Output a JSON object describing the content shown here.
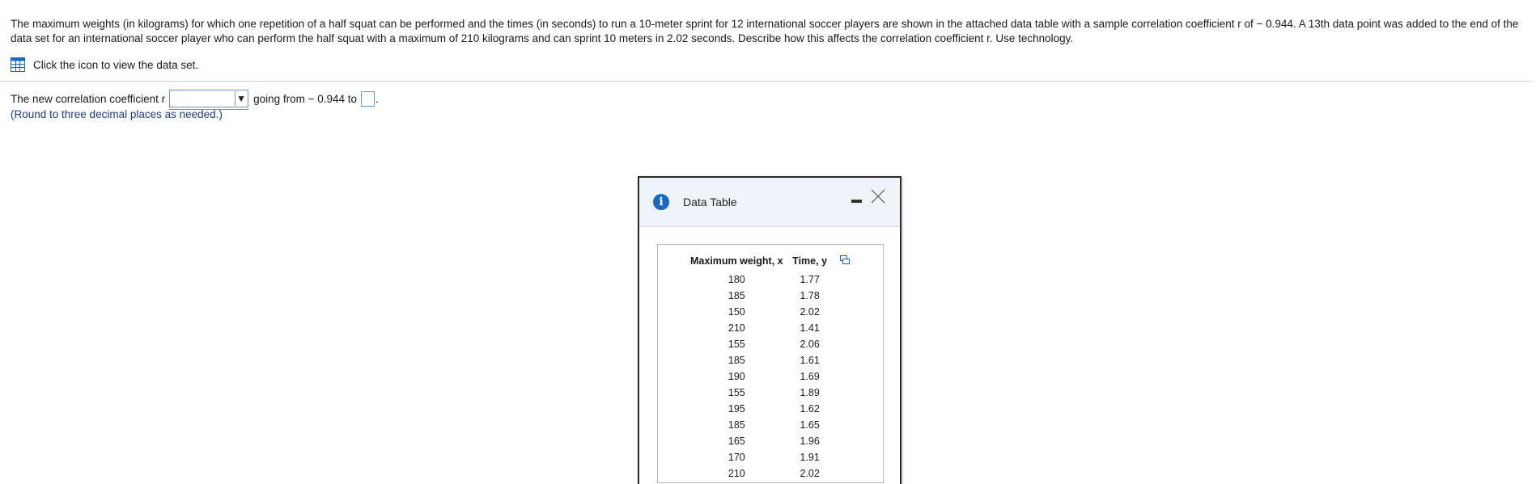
{
  "question": {
    "text": "The maximum weights (in kilograms) for which one repetition of a half squat can be performed and the times (in seconds) to run a 10-meter sprint for 12 international soccer players are shown in the attached data table with a sample correlation coefficient r of − 0.944. A 13th data point was added to the end of the data set for an international soccer player who can perform the half squat with a maximum of 210 kilograms and can sprint 10 meters in 2.02 seconds. Describe how this affects the correlation coefficient r. Use technology."
  },
  "dataset_link": {
    "icon": "grid-table-icon",
    "label": "Click the icon to view the data set."
  },
  "answer": {
    "prefix": "The new correlation coefficient r",
    "dropdown_value": "",
    "middle": "going from − 0.944 to",
    "value_input": "",
    "suffix": ".",
    "note": "(Round to three decimal places as needed.)"
  },
  "modal": {
    "title": "Data Table",
    "info_icon_glyph": "i",
    "columns": [
      "Maximum weight, x",
      "Time, y"
    ],
    "rows": [
      [
        "180",
        "1.77"
      ],
      [
        "185",
        "1.78"
      ],
      [
        "150",
        "2.02"
      ],
      [
        "210",
        "1.41"
      ],
      [
        "155",
        "2.06"
      ],
      [
        "185",
        "1.61"
      ],
      [
        "190",
        "1.69"
      ],
      [
        "155",
        "1.89"
      ],
      [
        "195",
        "1.62"
      ],
      [
        "185",
        "1.65"
      ],
      [
        "165",
        "1.96"
      ],
      [
        "170",
        "1.91"
      ],
      [
        "210",
        "2.02"
      ]
    ]
  },
  "colors": {
    "accent_blue": "#1a67c4",
    "note_blue": "#1d3c8c",
    "input_border": "#6c95c8",
    "header_bg": "#eef4fa"
  }
}
